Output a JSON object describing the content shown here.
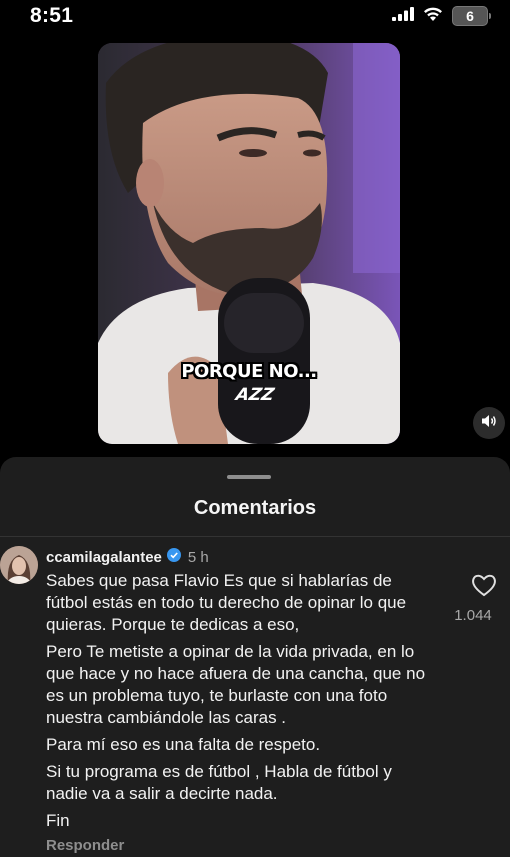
{
  "status_bar": {
    "time": "8:51",
    "battery": "6"
  },
  "video": {
    "caption": "PORQUE NO...",
    "logo_text": "AZZ"
  },
  "comments_panel": {
    "title": "Comentarios",
    "comment": {
      "username": "ccamilagalantee",
      "time": "5 h",
      "paragraphs": [
        "Sabes que pasa Flavio Es que si hablarías de fútbol estás en todo tu derecho de opinar lo que quieras. Porque te dedicas a eso,",
        "Pero Te metiste a opinar de la vida privada, en lo que hace y no hace afuera de una cancha, que no es un problema tuyo, te burlaste con una foto nuestra cambiándole las caras .",
        "Para mí eso es una falta de respeto.",
        "Si tu programa es de fútbol , Habla de fútbol y nadie va a salir a decirte nada.",
        "Fin"
      ],
      "like_count": "1.044",
      "reply_label": "Responder"
    }
  },
  "colors": {
    "sheet_bg": "#1e1e1e",
    "verified_blue": "#3897f0",
    "secondary_text": "#a8a8a8"
  },
  "icons": [
    "signal-icon",
    "wifi-icon",
    "battery-icon",
    "volume-icon",
    "verified-badge-icon",
    "heart-icon"
  ]
}
